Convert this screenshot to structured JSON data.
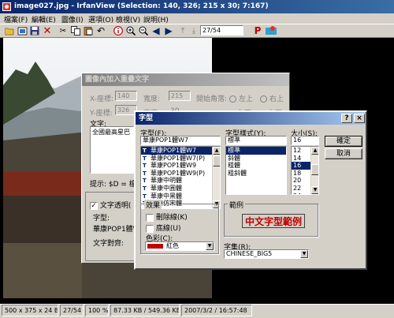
{
  "app": {
    "title": "image027.jpg - IrfanView (Selection: 140, 326; 215 x 30; 7:167)",
    "menu": [
      "檔案(F)",
      "編輯(E)",
      "圖像(I)",
      "選項(O)",
      "檢視(V)",
      "說明(H)"
    ],
    "page_field": "27/54",
    "toolbar_p": "P"
  },
  "status": {
    "dimensions": "500 x 375 x 24 BPP",
    "index": "27/54",
    "zoom": "100 %",
    "filesize": "87.33 KB / 549.36 KB",
    "datetime": "2007/3/2 / 16:57:48"
  },
  "text_dialog": {
    "title": "圖像內加入重疊文字",
    "x_label": "X-座標:",
    "x_value": "140",
    "width_label": "寬度:",
    "width_value": "215",
    "start_label": "開始角落:",
    "top_left": "左上",
    "top_right": "右上",
    "y_label": "Y-座標:",
    "y_value": "326",
    "height_label": "高度:",
    "height_value": "30",
    "bottom_left": "左下",
    "bottom_right": "右下",
    "text_label": "文字:",
    "text_value": "全國最高星巴",
    "hint": "提示: $D = 檔案",
    "transparent_label": "文字透明(",
    "font_label": "字型:",
    "font_value": "華康POP1體W",
    "align_label": "文字對齊:"
  },
  "font_dialog": {
    "title": "字型",
    "help": "?",
    "close": "×",
    "font_label": "字型(F):",
    "font_value": "華康POP1體W7",
    "fonts": [
      "華康POP1體W7",
      "華康POP1體W7(P)",
      "華康POP1體W9",
      "華康POP1體W9(P)",
      "華康中明體",
      "華康中圓體",
      "華康中黑體",
      "華康仿宋體"
    ],
    "selected_font": 0,
    "style_label": "字型樣式(Y):",
    "style_value": "標準",
    "styles": [
      "標準",
      "斜體",
      "粗體",
      "粗斜體"
    ],
    "selected_style": 0,
    "size_label": "大小(S):",
    "size_value": "16",
    "sizes": [
      "12",
      "14",
      "16",
      "18",
      "20",
      "22",
      "24"
    ],
    "selected_size": 2,
    "ok": "確定",
    "cancel": "取消",
    "effects_label": "效果",
    "strikeout": "刪除線(K)",
    "underline": "底線(U)",
    "color_label": "色彩(C):",
    "color_value": "紅色",
    "color_swatch": "#c00000",
    "sample_label": "範例",
    "sample_text": "中文字型範例",
    "script_label": "字集(R):",
    "script_value": "CHINESE_BIG5"
  }
}
